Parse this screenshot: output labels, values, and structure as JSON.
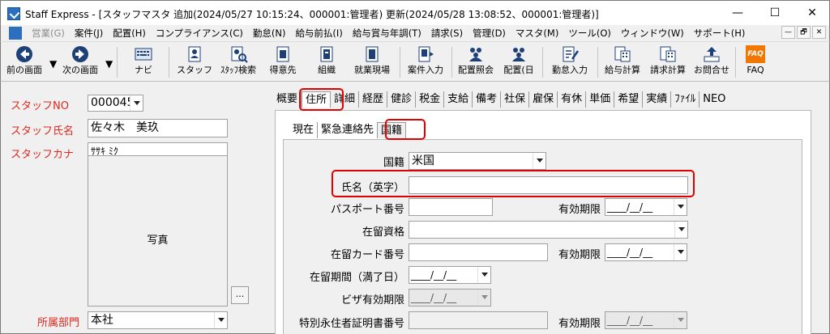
{
  "window": {
    "title": "Staff Express - [スタッフマスタ  追加(2024/05/27 10:15:24、000001:管理者)  更新(2024/05/28 13:08:52、000001:管理者)]",
    "minimize": "—",
    "maximize": "☐",
    "close": "✕"
  },
  "menu": {
    "items": [
      "営業(G)",
      "案件(J)",
      "配置(H)",
      "コンプライアンス(C)",
      "勤怠(N)",
      "給与前払(I)",
      "給与賞与年調(T)",
      "請求(S)",
      "管理(D)",
      "マスタ(M)",
      "ツール(O)",
      "ウィンドウ(W)",
      "サポート(H)"
    ],
    "mdi": [
      "—",
      "🗗",
      "✕"
    ]
  },
  "toolbar": {
    "prev": "前の画面",
    "next": "次の画面",
    "nav": "ナビ",
    "staff": "スタッフ",
    "staff_search": "ｽﾀｯﾌ検索",
    "customer": "得意先",
    "org": "組織",
    "worksite": "就業現場",
    "job_entry": "案件入力",
    "assign_inquiry": "配置照会",
    "assign_day": "配置(日",
    "attendance_entry": "勤怠入力",
    "payroll": "給与計算",
    "billing": "請求計算",
    "contact": "お問合せ",
    "faq": "FAQ",
    "faq_icon_text": "FAQ"
  },
  "staff": {
    "no_label": "スタッフNO",
    "no_value": "000045",
    "name_label": "スタッフ氏名",
    "name_value": "佐々木　美玖",
    "kana_label": "スタッフカナ",
    "kana_value": "ｻｻｷ ﾐｸ",
    "photo_label": "写真",
    "photo_button": "...",
    "dept_label": "所属部門",
    "dept_value": "本社"
  },
  "tabs": [
    "概要",
    "住所",
    "詳細",
    "経歴",
    "健診",
    "税金",
    "支給",
    "備考",
    "社保",
    "雇保",
    "有休",
    "単価",
    "希望",
    "実績",
    "ﾌｧｲﾙ",
    "NEO"
  ],
  "subtabs": [
    "現在",
    "緊急連絡先",
    "国籍"
  ],
  "form": {
    "nationality_label": "国籍",
    "nationality_value": "米国",
    "name_en_label": "氏名（英字）",
    "name_en_value": "",
    "passport_label": "パスポート番号",
    "passport_value": "",
    "expiry_label": "有効期限",
    "date_placeholder": "____/__/__",
    "status_label": "在留資格",
    "status_value": "",
    "residence_card_label": "在留カード番号",
    "residence_card_value": "",
    "residence_period_label": "在留期間（満了日）",
    "visa_expiry_label": "ビザ有効期限",
    "special_perm_label": "特別永住者証明書番号",
    "special_perm_value": ""
  }
}
